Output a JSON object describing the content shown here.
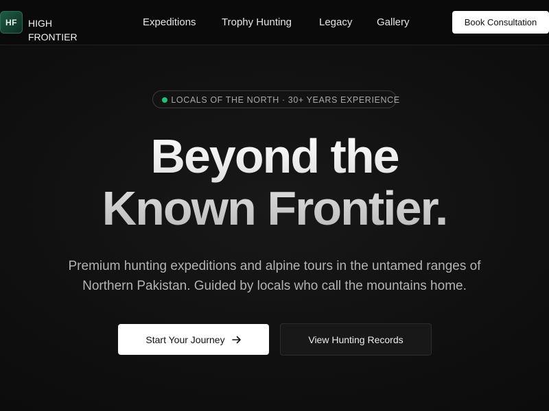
{
  "brand": {
    "logo_initials": "HF",
    "name": "HIGH FRONTIER"
  },
  "nav": {
    "links": [
      {
        "label": "Expeditions"
      },
      {
        "label": "Trophy Hunting"
      },
      {
        "label": "Legacy"
      },
      {
        "label": "Gallery"
      }
    ],
    "cta_label": "Book Consultation"
  },
  "badge": {
    "text": "LOCALS OF THE NORTH · 30+ YEARS EXPERIENCE",
    "dot_color": "#22c07a"
  },
  "hero": {
    "title_line1": "Beyond the",
    "title_line2": "Known Frontier.",
    "subtitle": "Premium hunting expeditions and alpine tours in the untamed ranges of Northern Pakistan. Guided by locals who call the mountains home.",
    "primary_cta": "Start Your Journey",
    "primary_cta_icon": "arrow-right-icon",
    "secondary_cta": "View Hunting Records"
  },
  "colors": {
    "background": "#0b0b0c",
    "accent_green": "#22c07a",
    "logo_green": "#1f5a44"
  }
}
